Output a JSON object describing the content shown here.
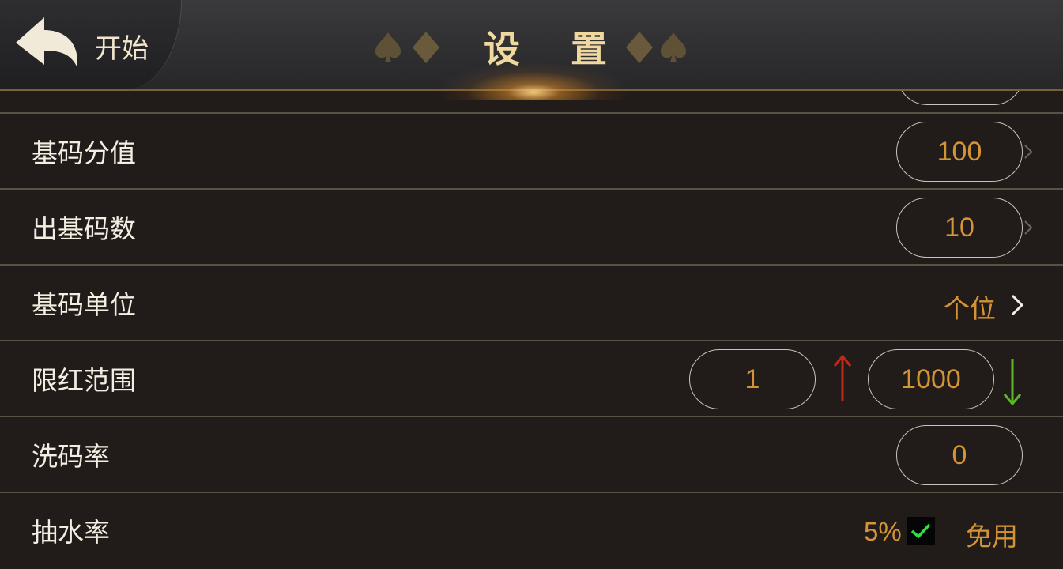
{
  "header": {
    "back_label": "开始",
    "title": "设 置"
  },
  "colors": {
    "value_text": "#d49436",
    "label_text": "#f4eee2",
    "title_text": "#f1d89e",
    "arrow_up": "#c0281a",
    "arrow_down": "#5cb82a",
    "check": "#2ee040"
  },
  "icons": {
    "back": "back-arrow-icon",
    "suits": [
      "spade-icon",
      "diamond-icon"
    ],
    "chevron": "chevron-right-icon",
    "up": "arrow-up-icon",
    "down": "arrow-down-icon",
    "check": "checkmark-icon"
  },
  "settings": {
    "base_chip_value": {
      "label": "基码分值",
      "value": "100"
    },
    "base_chip_count": {
      "label": "出基码数",
      "value": "10"
    },
    "base_chip_unit": {
      "label": "基码单位",
      "value": "个位"
    },
    "limit_range": {
      "label": "限红范围",
      "min": "1",
      "max": "1000"
    },
    "wash_rate": {
      "label": "洗码率",
      "value": "0"
    },
    "commission_rate": {
      "label": "抽水率",
      "value": "5%",
      "checked": true,
      "option": "免用"
    }
  }
}
